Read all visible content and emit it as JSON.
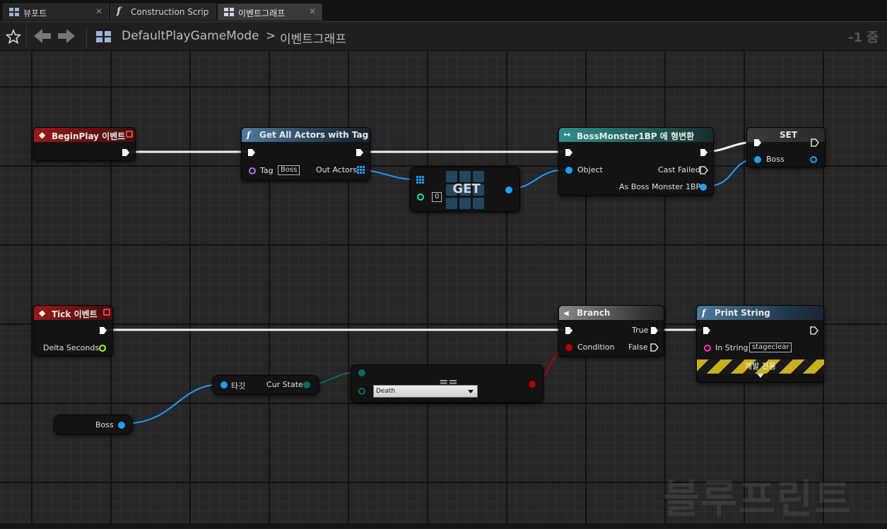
{
  "tabs": [
    {
      "label": "뷰포트",
      "icon": "viewport-icon"
    },
    {
      "label": "Construction Scrip",
      "icon": "function-icon"
    },
    {
      "label": "이벤트그래프",
      "icon": "event-graph-icon"
    }
  ],
  "breadcrumb": {
    "root": "DefaultPlayGameMode",
    "separator": ">",
    "current": "이벤트그래프"
  },
  "zoom": "-1 줌",
  "watermark": "블루프린트",
  "colors": {
    "exec": "#ffffff",
    "object": "#1aa0ff",
    "float": "#9aff3a",
    "string": "#ff2fb4",
    "bool": "#b00000",
    "name": "#b36cff",
    "enum": "#0a6b5e"
  },
  "nodes": {
    "begin_play": {
      "title": "BeginPlay 이벤트"
    },
    "get_all_actors": {
      "title": "Get All Actors with Tag",
      "tag_label": "Tag",
      "tag_value": "Boss",
      "out_label": "Out Actors"
    },
    "get": {
      "title": "GET",
      "index": "0"
    },
    "cast": {
      "title": "BossMonster1BP 에 형변환",
      "object_label": "Object",
      "failed_label": "Cast Failed",
      "as_label": "As Boss Monster 1BP"
    },
    "set": {
      "title": "SET",
      "var_label": "Boss"
    },
    "tick": {
      "title": "Tick 이벤트",
      "delta_label": "Delta Seconds"
    },
    "boss_var": {
      "label": "Boss"
    },
    "cur_state": {
      "target_label": "타깃",
      "out_label": "Cur State"
    },
    "equals": {
      "title": "==",
      "option": "Death"
    },
    "branch": {
      "title": "Branch",
      "cond_label": "Condition",
      "true_label": "True",
      "false_label": "False"
    },
    "print": {
      "title": "Print String",
      "in_label": "In String",
      "in_value": "stageclear",
      "dev_label": "개발 전용"
    }
  }
}
